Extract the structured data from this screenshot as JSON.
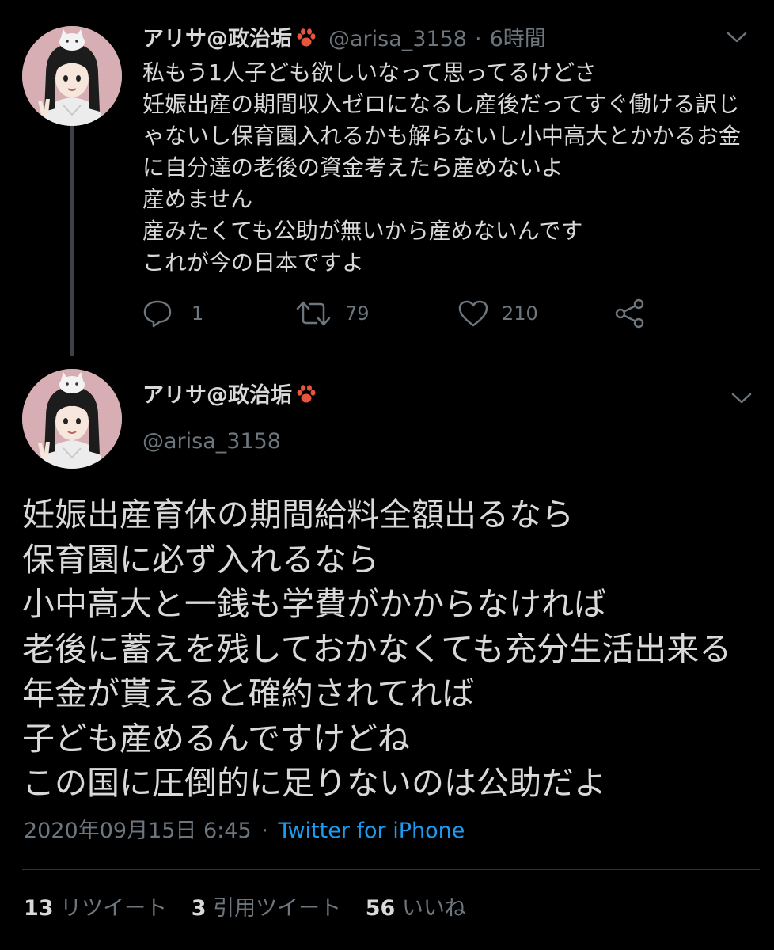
{
  "tweet1": {
    "author_name": "アリサ@政治垢",
    "handle": "@arisa_3158",
    "separator": "·",
    "time": "6時間",
    "text": "私もう1人子ども欲しいなって思ってるけどさ\n妊娠出産の期間収入ゼロになるし産後だってすぐ働ける訳じゃないし保育園入れるかも解らないし小中高大とかかるお金に自分達の老後の資金考えたら産めないよ\n産めません\n産みたくても公助が無いから産めないんです\nこれが今の日本ですよ",
    "actions": {
      "reply_count": "1",
      "retweet_count": "79",
      "like_count": "210"
    }
  },
  "tweet2": {
    "author_name": "アリサ@政治垢",
    "handle": "@arisa_3158",
    "text": "妊娠出産育休の期間給料全額出るなら\n保育園に必ず入れるなら\n小中高大と一銭も学費がかからなければ\n老後に蓄えを残しておかなくても充分生活出来る年金が貰えると確約されてれば\n子ども産めるんですけどね\nこの国に圧倒的に足りないのは公助だよ",
    "timestamp": "2020年09月15日 6:45",
    "separator": "·",
    "source": "Twitter for iPhone",
    "stats": {
      "retweets_count": "13",
      "retweets_label": "リツイート",
      "quotes_count": "3",
      "quotes_label": "引用ツイート",
      "likes_count": "56",
      "likes_label": "いいね"
    }
  },
  "icons": {
    "paw": "paw-print-emoji",
    "reply": "speech-bubble-icon",
    "retweet": "retweet-arrows-icon",
    "like": "heart-icon",
    "share": "share-icon",
    "more": "chevron-down-icon"
  },
  "colors": {
    "background": "#000000",
    "text": "#d9d9d9",
    "secondary": "#6e767d",
    "link": "#1d9bf0",
    "avatar_bg": "#d6aeb4",
    "paw": "#e8553f"
  }
}
